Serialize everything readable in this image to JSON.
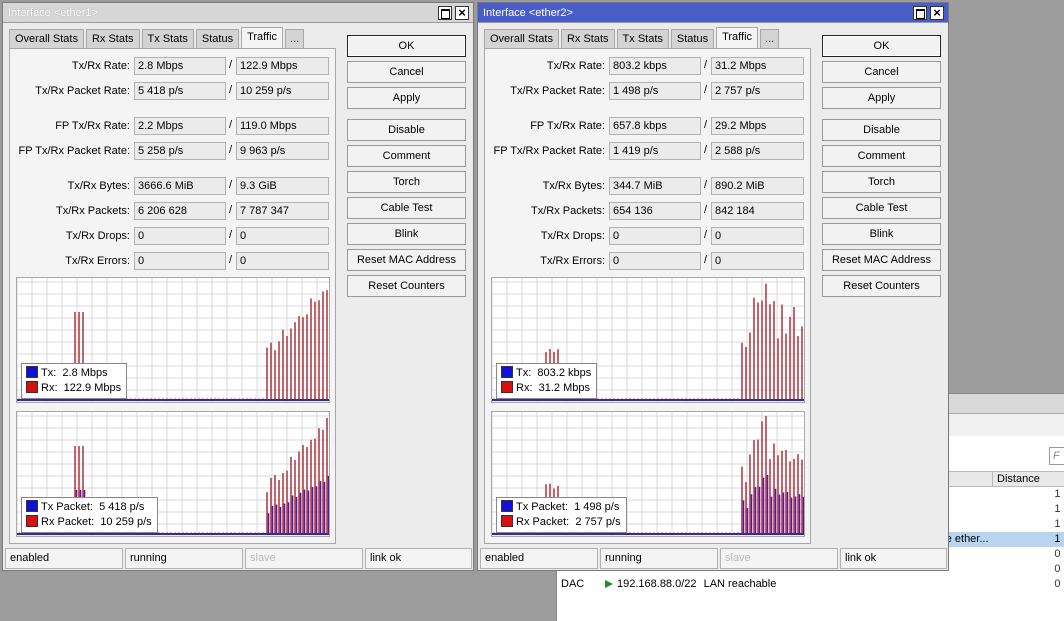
{
  "background": {
    "find_placeholder": "F",
    "columns": [
      "Distance"
    ],
    "rows": [
      {
        "text": "",
        "distance": "1",
        "selected": false
      },
      {
        "text": "",
        "distance": "1",
        "selected": false
      },
      {
        "text": "",
        "distance": "1",
        "selected": false
      },
      {
        "text": "ble ether...",
        "distance": "1",
        "selected": true
      },
      {
        "text": "",
        "distance": "0",
        "selected": false
      },
      {
        "text": "",
        "distance": "0",
        "selected": false
      },
      {
        "text": "",
        "distance": "0",
        "selected": false
      }
    ],
    "last_row": {
      "type": "DAC",
      "address": "192.168.88.0/22",
      "gateway": "LAN reachable",
      "distance": "0"
    }
  },
  "windows": [
    {
      "title": "Interface <ether1>",
      "tabs": [
        "Overall Stats",
        "Rx Stats",
        "Tx Stats",
        "Status",
        "Traffic",
        "..."
      ],
      "active_tab": "Traffic",
      "fields": [
        {
          "label": "Tx/Rx Rate:",
          "tx": "2.8 Mbps",
          "rx": "122.9 Mbps"
        },
        {
          "label": "Tx/Rx Packet Rate:",
          "tx": "5 418 p/s",
          "rx": "10 259 p/s"
        },
        {
          "label": "FP Tx/Rx Rate:",
          "tx": "2.2 Mbps",
          "rx": "119.0 Mbps"
        },
        {
          "label": "FP Tx/Rx Packet Rate:",
          "tx": "5 258 p/s",
          "rx": "9 963 p/s"
        },
        {
          "label": "Tx/Rx Bytes:",
          "tx": "3666.6 MiB",
          "rx": "9.3 GiB"
        },
        {
          "label": "Tx/Rx Packets:",
          "tx": "6 206 628",
          "rx": "7 787 347"
        },
        {
          "label": "Tx/Rx Drops:",
          "tx": "0",
          "rx": "0"
        },
        {
          "label": "Tx/Rx Errors:",
          "tx": "0",
          "rx": "0"
        }
      ],
      "rate_legend": {
        "tx_label": "Tx:",
        "tx_value": "2.8 Mbps",
        "rx_label": "Rx:",
        "rx_value": "122.9 Mbps"
      },
      "packet_legend": {
        "tx_label": "Tx Packet:",
        "tx_value": "5 418 p/s",
        "rx_label": "Rx Packet:",
        "rx_value": "10 259 p/s"
      },
      "buttons": [
        "OK",
        "Cancel",
        "Apply",
        "Disable",
        "Comment",
        "Torch",
        "Cable Test",
        "Blink",
        "Reset MAC Address",
        "Reset Counters"
      ],
      "status": [
        "enabled",
        "running",
        "slave",
        "link ok"
      ]
    },
    {
      "title": "Interface <ether2>",
      "tabs": [
        "Overall Stats",
        "Rx Stats",
        "Tx Stats",
        "Status",
        "Traffic",
        "..."
      ],
      "active_tab": "Traffic",
      "fields": [
        {
          "label": "Tx/Rx Rate:",
          "tx": "803.2 kbps",
          "rx": "31.2 Mbps"
        },
        {
          "label": "Tx/Rx Packet Rate:",
          "tx": "1 498 p/s",
          "rx": "2 757 p/s"
        },
        {
          "label": "FP Tx/Rx Rate:",
          "tx": "657.8 kbps",
          "rx": "29.2 Mbps"
        },
        {
          "label": "FP Tx/Rx Packet Rate:",
          "tx": "1 419 p/s",
          "rx": "2 588 p/s"
        },
        {
          "label": "Tx/Rx Bytes:",
          "tx": "344.7 MiB",
          "rx": "890.2 MiB"
        },
        {
          "label": "Tx/Rx Packets:",
          "tx": "654 136",
          "rx": "842 184"
        },
        {
          "label": "Tx/Rx Drops:",
          "tx": "0",
          "rx": "0"
        },
        {
          "label": "Tx/Rx Errors:",
          "tx": "0",
          "rx": "0"
        }
      ],
      "rate_legend": {
        "tx_label": "Tx:",
        "tx_value": "803.2 kbps",
        "rx_label": "Rx:",
        "rx_value": "31.2 Mbps"
      },
      "packet_legend": {
        "tx_label": "Tx Packet:",
        "tx_value": "1 498 p/s",
        "rx_label": "Rx Packet:",
        "rx_value": "2 757 p/s"
      },
      "buttons": [
        "OK",
        "Cancel",
        "Apply",
        "Disable",
        "Comment",
        "Torch",
        "Cable Test",
        "Blink",
        "Reset MAC Address",
        "Reset Counters"
      ],
      "status": [
        "enabled",
        "running",
        "slave",
        "link ok"
      ]
    }
  ],
  "colors": {
    "tx": "#1010d8",
    "rx": "#d81010",
    "rx_bar": "#b0404a",
    "tx_bar": "#5a1890",
    "grid": "#d8d8d8",
    "active_title": "#4a5cc8"
  }
}
